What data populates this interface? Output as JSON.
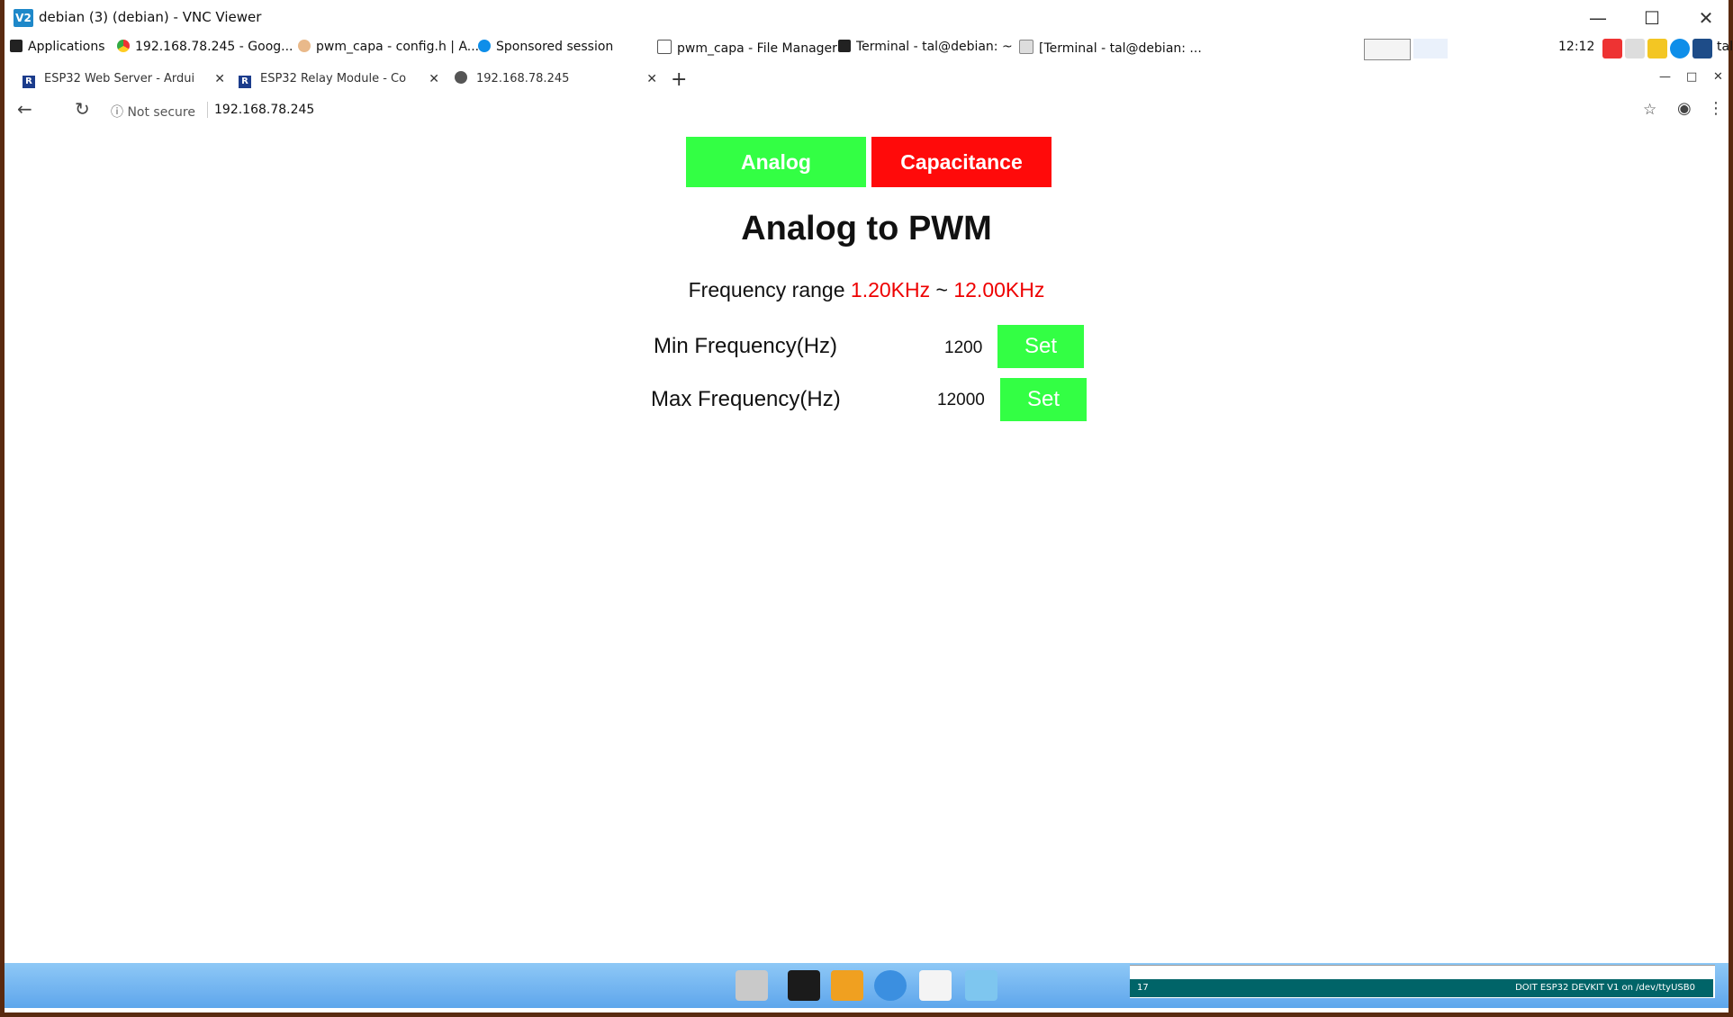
{
  "window": {
    "title": "debian (3) (debian) - VNC Viewer",
    "icon": "V2"
  },
  "taskbar": {
    "items": [
      "Applications",
      "192.168.78.245 - Goog...",
      "pwm_capa - config.h | A...",
      "Sponsored session",
      "pwm_capa - File Manager",
      "Terminal - tal@debian: ~",
      "[Terminal - tal@debian: ..."
    ],
    "clock": "12:12",
    "user": "tal"
  },
  "browser": {
    "tabs": [
      {
        "label": "ESP32 Web Server - Ardui",
        "fav": "R"
      },
      {
        "label": "ESP32 Relay Module - Co",
        "fav": "R"
      },
      {
        "label": "192.168.78.245",
        "fav": ""
      }
    ],
    "new_tab": "+",
    "security": "Not secure",
    "url": "192.168.78.245"
  },
  "page": {
    "buttons": {
      "analog": "Analog",
      "capacitance": "Capacitance"
    },
    "heading": "Analog to PWM",
    "range_prefix": "Frequency range",
    "range_min": "1.20KHz",
    "range_sep": "~",
    "range_max": "12.00KHz",
    "min_label": "Min Frequency(Hz)",
    "min_value": "1200",
    "max_label": "Max Frequency(Hz)",
    "max_value": "12000",
    "set_label": "Set"
  },
  "ide": {
    "line": "17",
    "board": "DOIT ESP32 DEVKIT V1 on /dev/ttyUSB0"
  },
  "colors": {
    "green": "#33ff44",
    "red": "#ff0a0a",
    "range_red": "#e00000",
    "ide_teal": "#006468"
  }
}
